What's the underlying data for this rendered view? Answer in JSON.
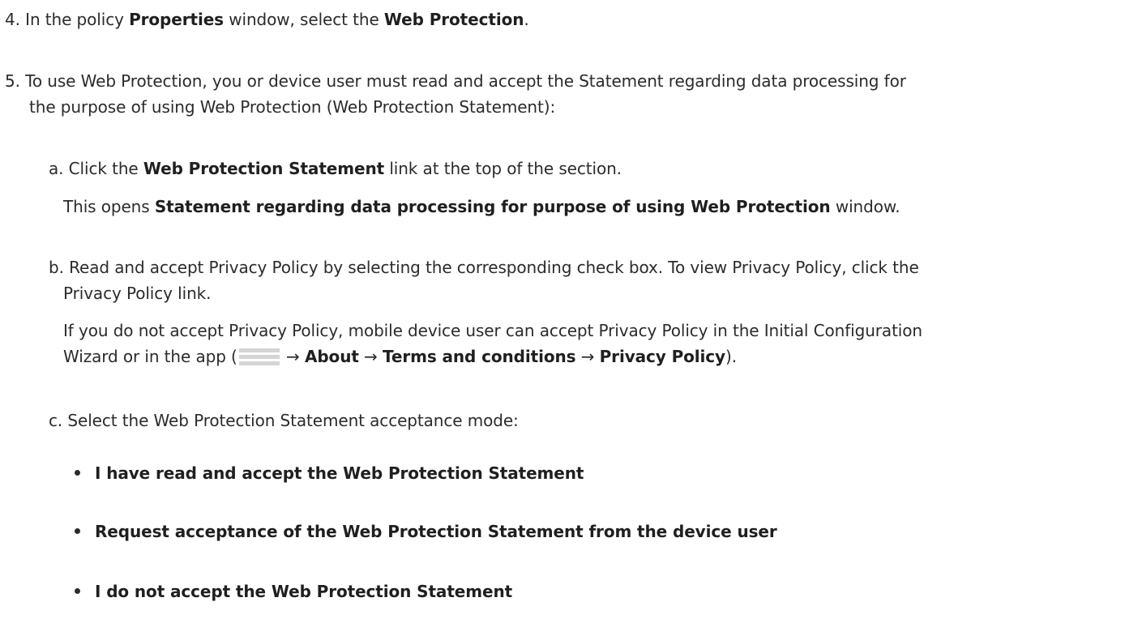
{
  "step4": {
    "prefix": "4. In the policy ",
    "properties": "Properties",
    "middle": " window, select the ",
    "web_protection": "Web Protection",
    "suffix": "."
  },
  "step5": {
    "line1": "5. To use Web Protection, you or device user must read and accept the Statement regarding data processing for",
    "line2": "the purpose of using Web Protection (Web Protection Statement):"
  },
  "sub_a": {
    "prefix": "a. Click the ",
    "link": "Web Protection Statement",
    "suffix": " link at the top of the section.",
    "opens_prefix": "This opens ",
    "window_name": "Statement regarding data processing for purpose of using Web Protection",
    "opens_suffix": " window."
  },
  "sub_b": {
    "line1": "b. Read and accept Privacy Policy by selecting the corresponding check box. To view Privacy Policy, click the",
    "line2": "Privacy Policy link.",
    "note_line1": "If you do not accept Privacy Policy, mobile device user can accept Privacy Policy in the Initial Configuration",
    "note_prefix": "Wizard or in the app (",
    "arrow1": " → ",
    "about": "About",
    "arrow2": " → ",
    "terms": "Terms and conditions",
    "arrow3": " → ",
    "privacy": "Privacy Policy",
    "note_suffix": ")."
  },
  "sub_c": {
    "intro": "c. Select the Web Protection Statement acceptance mode:",
    "options": [
      "I have read and accept the Web Protection Statement",
      "Request acceptance of the Web Protection Statement from the device user",
      "I do not accept the Web Protection Statement"
    ]
  },
  "icons": {
    "menu": "hamburger-menu-icon"
  }
}
